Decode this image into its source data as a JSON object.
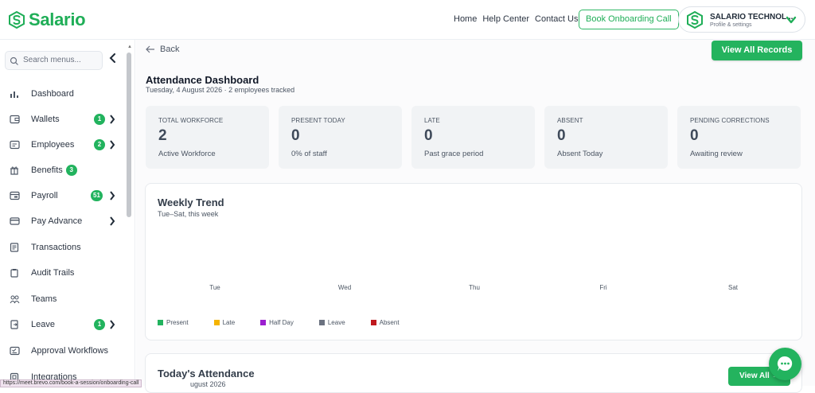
{
  "colors": {
    "brand": "#1fae57",
    "button": "#24b35e",
    "badge": "#22b35e"
  },
  "header": {
    "logo_text": "Salario",
    "nav": [
      "Home",
      "Help Center",
      "Contact Us"
    ],
    "book_button": "Book Onboarding Call",
    "profile": {
      "name": "SALARIO TECHNOL....",
      "subtitle": "Profile & settings"
    }
  },
  "sidebar": {
    "search_placeholder": "Search menus...",
    "items": [
      {
        "label": "Dashboard",
        "icon": "bar-chart-icon",
        "badge": "",
        "chevron": false
      },
      {
        "label": "Wallets",
        "icon": "wallet-icon",
        "badge": "1",
        "chevron": true
      },
      {
        "label": "Employees",
        "icon": "id-card-icon",
        "badge": "2",
        "chevron": true
      },
      {
        "label": "Benefits",
        "icon": "gift-icon",
        "badge": "3",
        "chevron": false
      },
      {
        "label": "Payroll",
        "icon": "payroll-icon",
        "badge": "51",
        "chevron": true
      },
      {
        "label": "Pay Advance",
        "icon": "card-icon",
        "badge": "",
        "chevron": true
      },
      {
        "label": "Transactions",
        "icon": "receipt-icon",
        "badge": "",
        "chevron": false
      },
      {
        "label": "Audit Trails",
        "icon": "clipboard-icon",
        "badge": "",
        "chevron": false
      },
      {
        "label": "Teams",
        "icon": "team-icon",
        "badge": "",
        "chevron": false
      },
      {
        "label": "Leave",
        "icon": "leave-icon",
        "badge": "1",
        "chevron": true
      },
      {
        "label": "Approval Workflows",
        "icon": "workflow-icon",
        "badge": "",
        "chevron": false
      },
      {
        "label": "Integrations",
        "icon": "plug-icon",
        "badge": "",
        "chevron": false
      }
    ]
  },
  "status_url": "https://meet.brevo.com/book-a-session/onboarding-call",
  "main": {
    "back_label": "Back",
    "view_all_records": "View All Records",
    "title": "Attendance Dashboard",
    "subtitle": "Tuesday, 4 August 2026 · 2 employees tracked",
    "stats": [
      {
        "label": "TOTAL WORKFORCE",
        "value": "2",
        "desc": "Active Workforce"
      },
      {
        "label": "PRESENT TODAY",
        "value": "0",
        "desc": "0% of staff"
      },
      {
        "label": "LATE",
        "value": "0",
        "desc": "Past grace period"
      },
      {
        "label": "ABSENT",
        "value": "0",
        "desc": "Absent Today"
      },
      {
        "label": "PENDING CORRECTIONS",
        "value": "0",
        "desc": "Awaiting review"
      }
    ],
    "weekly_trend": {
      "title": "Weekly Trend",
      "subtitle": "Tue–Sat, this week",
      "days": [
        "Tue",
        "Wed",
        "Thu",
        "Fri",
        "Sat"
      ],
      "legend": [
        {
          "label": "Present",
          "color": "#22b35e"
        },
        {
          "label": "Late",
          "color": "#f5b400"
        },
        {
          "label": "Half Day",
          "color": "#9b1fd0"
        },
        {
          "label": "Leave",
          "color": "#6b7280"
        },
        {
          "label": "Absent",
          "color": "#c0191e"
        }
      ]
    },
    "todays_attendance": {
      "title": "Today's Attendance",
      "subtitle": "ugust 2026",
      "button": "View All →"
    }
  }
}
